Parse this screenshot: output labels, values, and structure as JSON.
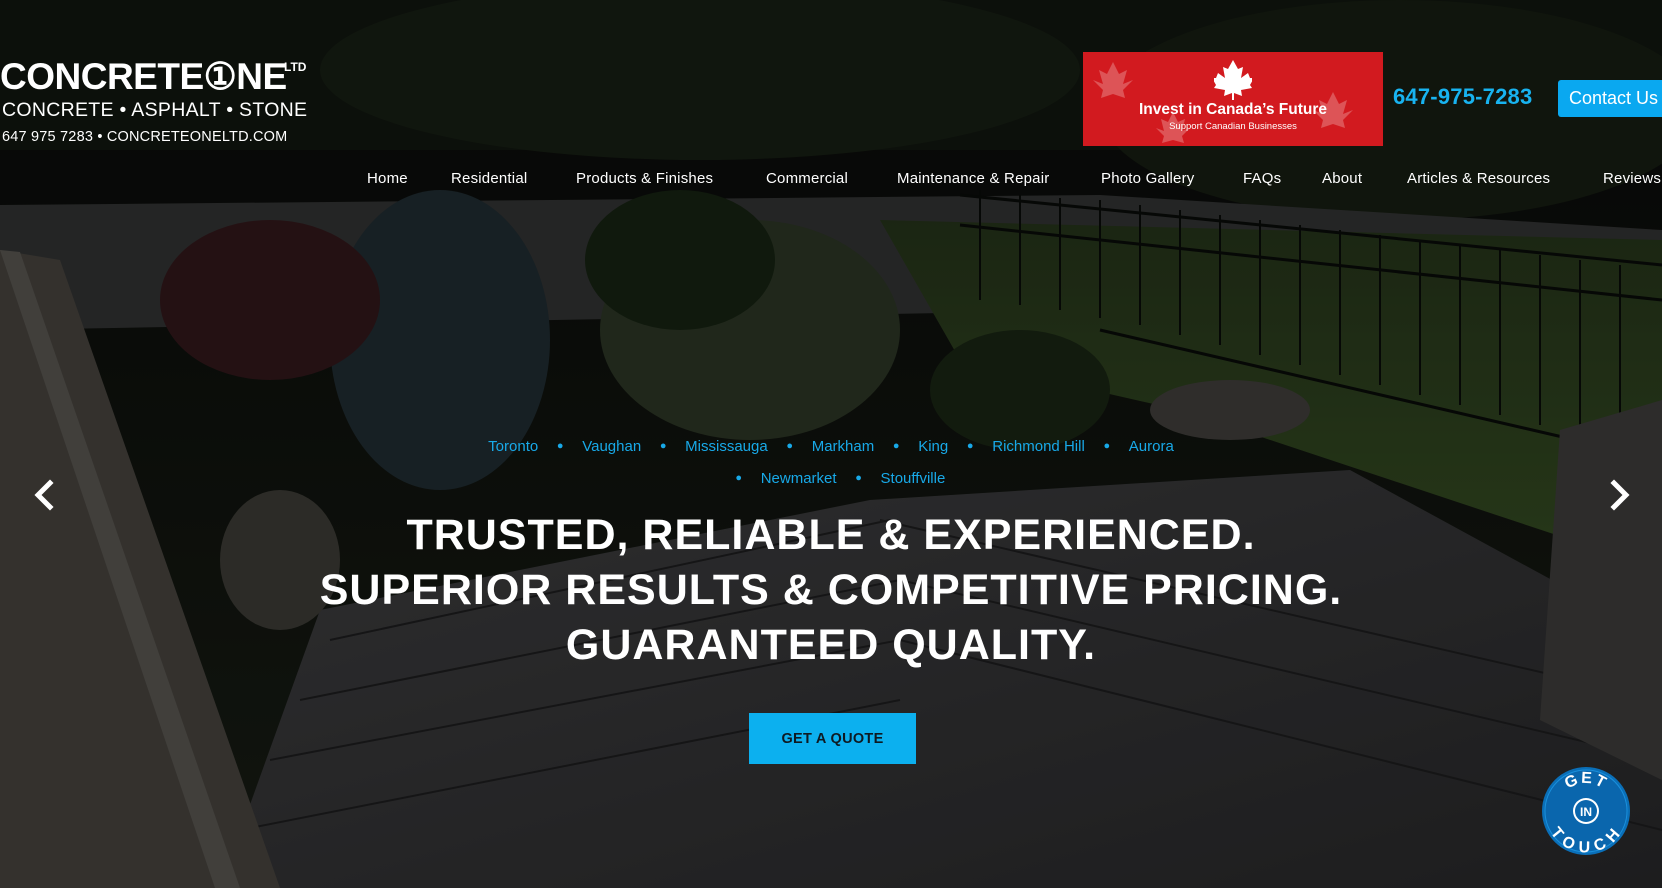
{
  "logo": {
    "line1": "CONCRETE①NE",
    "ltd": "LTD",
    "line2": "CONCRETE • ASPHALT • STONE",
    "line3": "647 975 7283 • CONCRETEONELTD.COM"
  },
  "canada_banner": {
    "title": "Invest in Canada’s Future",
    "subtitle": "Support Canadian Businesses"
  },
  "header": {
    "phone": "647-975-7283",
    "contact_label": "Contact Us"
  },
  "nav": {
    "items": [
      {
        "label": "Home"
      },
      {
        "label": "Residential"
      },
      {
        "label": "Products & Finishes"
      },
      {
        "label": "Commercial"
      },
      {
        "label": "Maintenance & Repair"
      },
      {
        "label": "Photo Gallery"
      },
      {
        "label": "FAQs"
      },
      {
        "label": "About"
      },
      {
        "label": "Articles & Resources"
      },
      {
        "label": "Reviews"
      }
    ]
  },
  "hero": {
    "cities_row1": [
      "Toronto",
      "Vaughan",
      "Mississauga",
      "Markham",
      "King",
      "Richmond Hill",
      "Aurora"
    ],
    "cities_row2": [
      "Newmarket",
      "Stouffville"
    ],
    "headline": [
      "TRUSTED, RELIABLE & EXPERIENCED.",
      "SUPERIOR RESULTS & COMPETITIVE PRICING.",
      "GUARANTEED QUALITY."
    ],
    "cta_label": "GET A QUOTE"
  },
  "get_in_touch": {
    "top": "GET",
    "middle": "IN",
    "bottom": "TOUCH"
  },
  "colors": {
    "accent": "#0cb0ef",
    "phone": "#18b3f0",
    "canada_red": "#d21a1f"
  },
  "icons": [
    "chevron-left-icon",
    "chevron-right-icon",
    "maple-leaf-icon"
  ]
}
